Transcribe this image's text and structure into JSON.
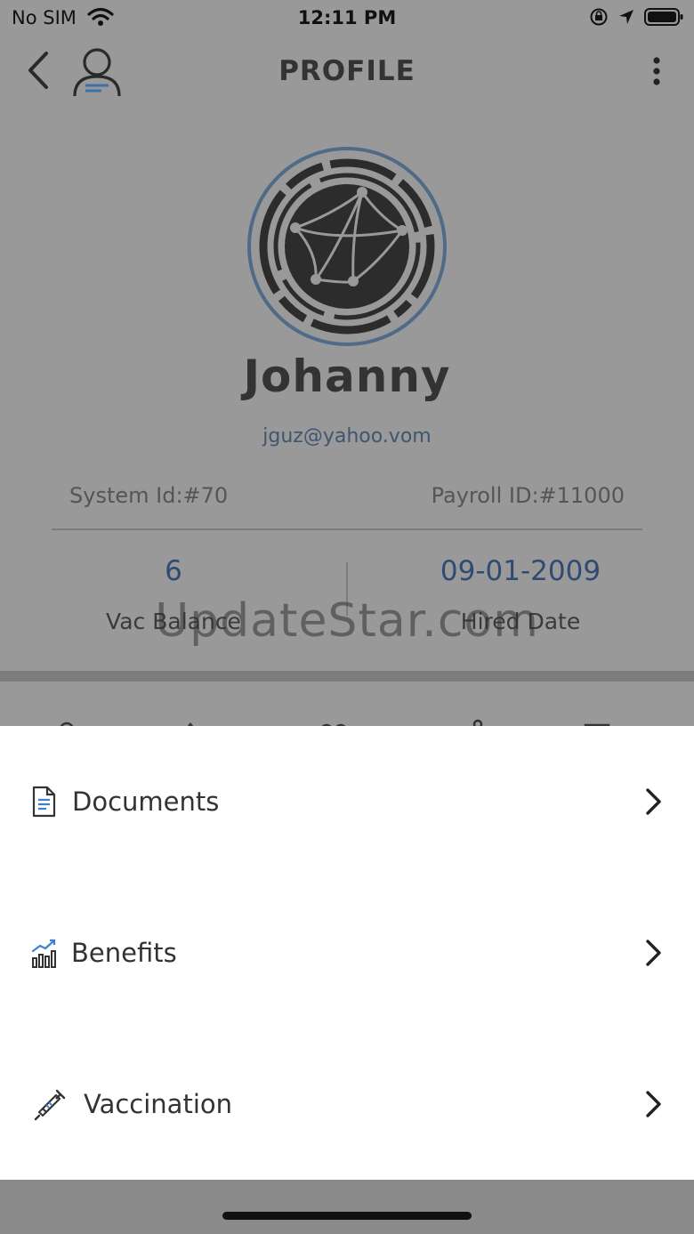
{
  "status_bar": {
    "carrier": "No SIM",
    "time": "12:11 PM"
  },
  "nav": {
    "title": "PROFILE"
  },
  "profile": {
    "name": "Johanny",
    "email": "jguz@yahoo.vom",
    "system_id": "System Id:#70",
    "payroll_id": "Payroll ID:#11000",
    "vac_balance_value": "6",
    "vac_balance_label": "Vac Balance",
    "hired_date_value": "09-01-2009",
    "hired_date_label": "Hired Date"
  },
  "watermark": "UpdateStar.com",
  "sheet": {
    "items": [
      {
        "label": "Documents",
        "icon": "document-icon"
      },
      {
        "label": "Benefits",
        "icon": "chart-icon"
      },
      {
        "label": "Vaccination",
        "icon": "syringe-icon"
      }
    ]
  },
  "colors": {
    "accent": "#2f4b73",
    "avatar_ring": "#4f6b87",
    "icon_blue": "#3f7fd0",
    "overlay": "#999999"
  }
}
